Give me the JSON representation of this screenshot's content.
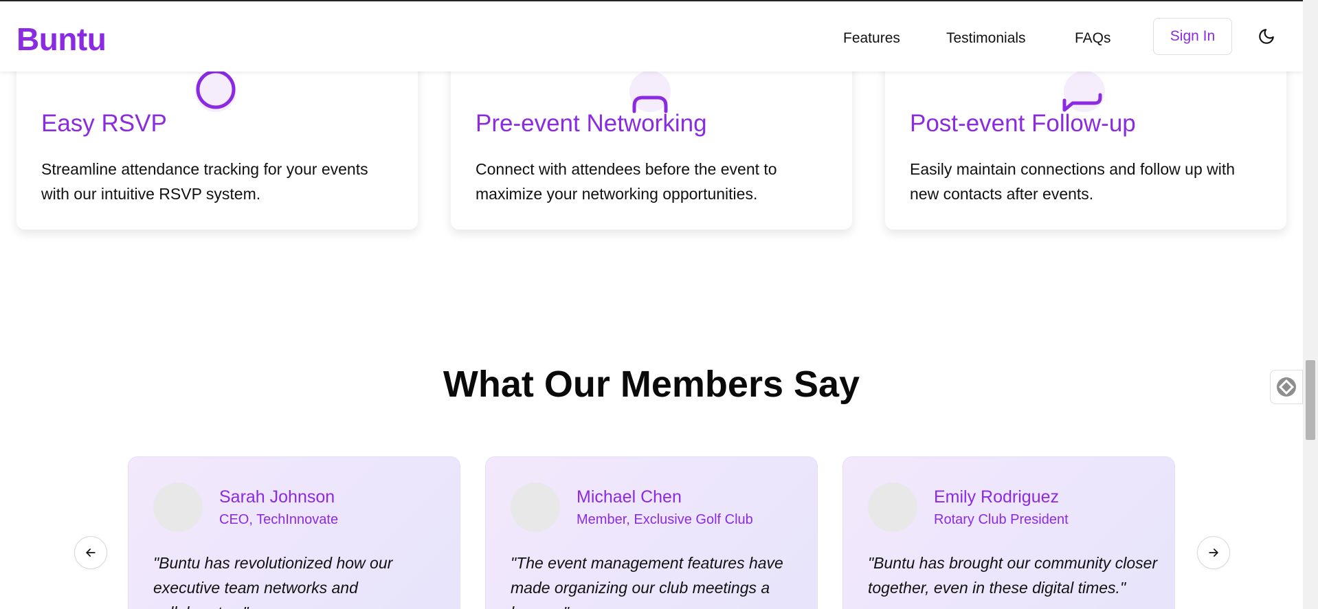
{
  "header": {
    "logo": "Buntu",
    "nav": [
      "Features",
      "Testimonials",
      "FAQs"
    ],
    "signin_label": "Sign In",
    "theme_icon": "moon-icon"
  },
  "features": [
    {
      "icon": "clock-icon",
      "title": "Easy RSVP",
      "description": "Streamline attendance tracking for your events with our intuitive RSVP system."
    },
    {
      "icon": "user-icon",
      "title": "Pre-event Networking",
      "description": "Connect with attendees before the event to maximize your networking opportunities."
    },
    {
      "icon": "message-icon",
      "title": "Post-event Follow-up",
      "description": "Easily maintain connections and follow up with new contacts after events."
    }
  ],
  "testimonials": {
    "title": "What Our Members Say",
    "items": [
      {
        "name": "Sarah Johnson",
        "role": "CEO, TechInnovate",
        "quote": "\"Buntu has revolutionized how our executive team networks and collaborates.\""
      },
      {
        "name": "Michael Chen",
        "role": "Member, Exclusive Golf Club",
        "quote": "\"The event management features have made organizing our club meetings a breeze.\""
      },
      {
        "name": "Emily Rodriguez",
        "role": "Rotary Club President",
        "quote": "\"Buntu has brought our community closer together, even in these digital times.\""
      }
    ],
    "prev_icon": "arrow-left-icon",
    "next_icon": "arrow-right-icon"
  },
  "colors": {
    "brand": "#8a2be2",
    "card_gradient_start": "#f3e8fc",
    "card_gradient_end": "#e6e4fb"
  }
}
